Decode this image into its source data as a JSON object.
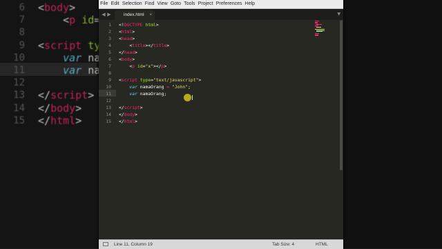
{
  "menu": [
    "File",
    "Edit",
    "Selection",
    "Find",
    "View",
    "Goto",
    "Tools",
    "Project",
    "Preferences",
    "Help"
  ],
  "tab": {
    "filename": "index.html",
    "close": "×"
  },
  "nav": {
    "back": "◀",
    "forward": "▶",
    "dropdown": "▼"
  },
  "lines": [
    {
      "n": "1",
      "html": "<span class='c-plain'>&lt;!</span><span class='c-red'>DOCTYPE</span><span class='c-plain'> </span><span class='c-grn'>html</span><span class='c-plain'>&gt;</span>"
    },
    {
      "n": "2",
      "html": "<span class='c-plain'>&lt;</span><span class='c-red'>html</span><span class='c-plain'>&gt;</span>"
    },
    {
      "n": "3",
      "html": "<span class='c-plain'>&lt;</span><span class='c-red'>head</span><span class='c-plain'>&gt;</span>"
    },
    {
      "n": "4",
      "html": "<span class='c-plain'>    &lt;</span><span class='c-red'>title</span><span class='c-plain'>&gt;&lt;/</span><span class='c-red'>title</span><span class='c-plain'>&gt;</span>"
    },
    {
      "n": "5",
      "html": "<span class='c-plain'>&lt;/</span><span class='c-red'>head</span><span class='c-plain'>&gt;</span>"
    },
    {
      "n": "6",
      "html": "<span class='c-plain'>&lt;</span><span class='c-red'>body</span><span class='c-plain'>&gt;</span>"
    },
    {
      "n": "7",
      "html": "<span class='c-plain'>    &lt;</span><span class='c-red'>p</span><span class='c-plain'> </span><span class='c-grn'>id</span><span class='c-plain'>=</span><span class='c-yel'>\"x\"</span><span class='c-plain'>&gt;&lt;/</span><span class='c-red'>p</span><span class='c-plain'>&gt;</span>"
    },
    {
      "n": "8",
      "html": ""
    },
    {
      "n": "9",
      "html": "<span class='c-plain'>&lt;</span><span class='c-red'>script</span><span class='c-plain'> </span><span class='c-grn'>type</span><span class='c-plain'>=</span><span class='c-yel'>\"text/javascript\"</span><span class='c-plain'>&gt;</span>"
    },
    {
      "n": "10",
      "html": "<span class='c-plain'>    </span><span class='c-blu'>var</span><span class='c-plain'> namaOrang </span><span class='c-red'>=</span><span class='c-plain'> </span><span class='c-yel'>\"John\"</span><span class='c-plain'>;</span>"
    },
    {
      "n": "11",
      "html": "<span class='c-plain'>    </span><span class='c-blu'>var</span><span class='c-plain'> namaOrang;</span>"
    },
    {
      "n": "12",
      "html": ""
    },
    {
      "n": "13",
      "html": "<span class='c-plain'>&lt;/</span><span class='c-red'>script</span><span class='c-plain'>&gt;</span>"
    },
    {
      "n": "14",
      "html": "<span class='c-plain'>&lt;/</span><span class='c-red'>body</span><span class='c-plain'>&gt;</span>"
    },
    {
      "n": "15",
      "html": "<span class='c-plain'>&lt;/</span><span class='c-red'>html</span><span class='c-plain'>&gt;</span>"
    }
  ],
  "bg_lines": [
    {
      "n": "6",
      "html": "<span class='c-plain'>&lt;</span><span class='c-red'>body</span><span class='c-plain'>&gt;</span>"
    },
    {
      "n": "7",
      "html": "<span class='c-plain'>    &lt;</span><span class='c-red'>p</span><span class='c-plain'> </span><span class='c-grn'>id</span><span class='c-plain'>=</span><span class='c-yel'>\"</span>"
    },
    {
      "n": "8",
      "html": ""
    },
    {
      "n": "9",
      "html": "<span class='c-plain'>&lt;</span><span class='c-red'>script</span><span class='c-plain'> </span><span class='c-grn'>type</span>"
    },
    {
      "n": "10",
      "html": "<span class='c-plain'>    </span><span class='c-blu'>var</span><span class='c-plain'> nam</span>"
    },
    {
      "n": "11",
      "html": "<span class='c-plain'>    </span><span class='c-blu'>var</span><span class='c-plain'> nam</span>"
    },
    {
      "n": "12",
      "html": ""
    },
    {
      "n": "13",
      "html": "<span class='c-plain'>&lt;/</span><span class='c-red'>script</span><span class='c-plain'>&gt;</span>"
    },
    {
      "n": "14",
      "html": "<span class='c-plain'>&lt;/</span><span class='c-red'>body</span><span class='c-plain'>&gt;</span>"
    },
    {
      "n": "15",
      "html": "<span class='c-plain'>&lt;/</span><span class='c-red'>html</span><span class='c-plain'>&gt;</span>"
    }
  ],
  "status": {
    "position": "Line 11, Column 19",
    "tab_size": "Tab Size: 4",
    "syntax": "HTML"
  },
  "colors": {
    "editor_bg": "#272822",
    "keyword": "#f92672",
    "string": "#e6db74",
    "storage": "#66d9ef",
    "attr": "#a6e22e"
  },
  "icons": {
    "cursor": "mouse-cursor-icon",
    "status_panel": "panel-toggle-icon"
  }
}
